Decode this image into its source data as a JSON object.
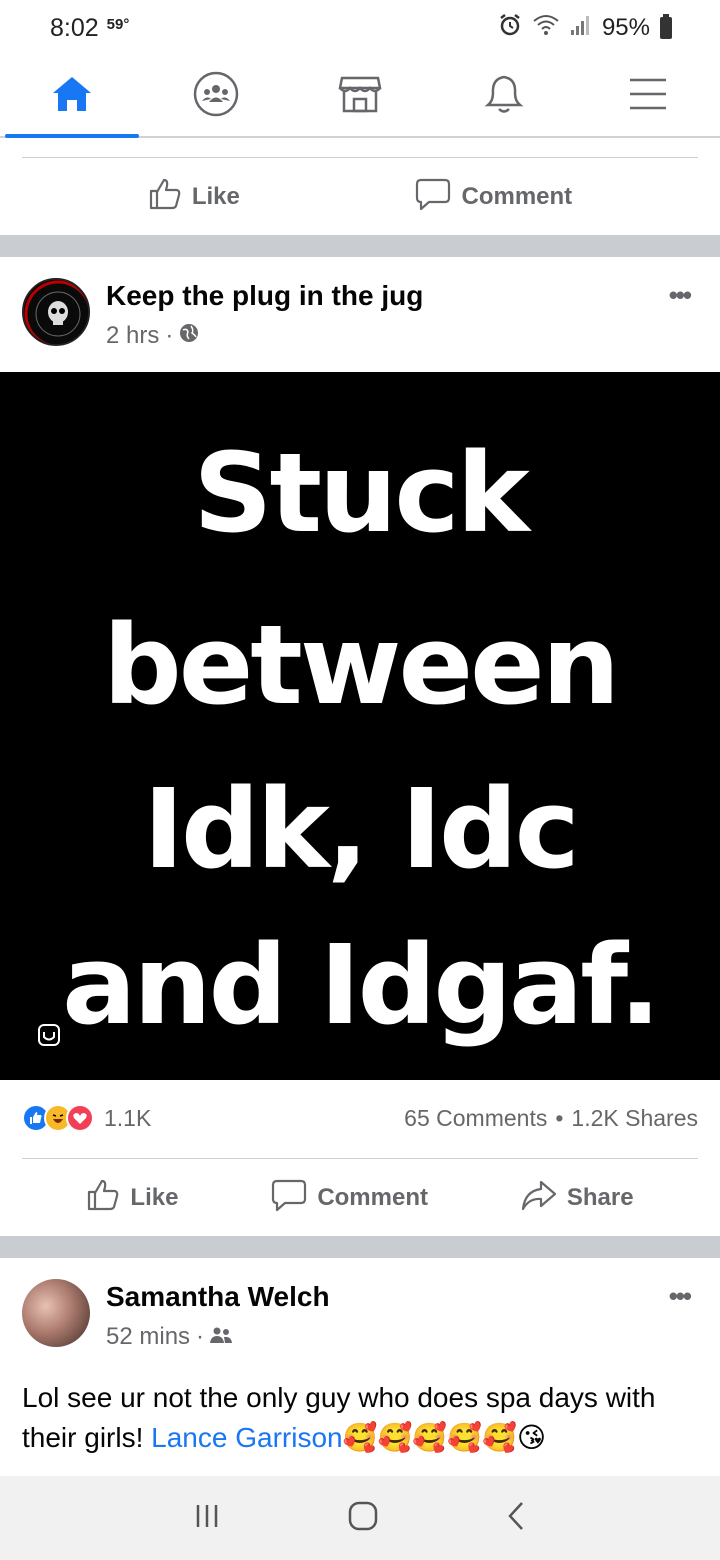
{
  "status_bar": {
    "time": "8:02",
    "temperature": "59°",
    "battery": "95%",
    "icons": [
      "alarm-icon",
      "wifi-icon",
      "signal-icon",
      "battery-icon"
    ]
  },
  "nav_tabs": [
    {
      "name": "home",
      "icon": "home-icon",
      "active": true
    },
    {
      "name": "groups",
      "icon": "groups-icon",
      "active": false
    },
    {
      "name": "marketplace",
      "icon": "marketplace-icon",
      "active": false
    },
    {
      "name": "notifications",
      "icon": "bell-icon",
      "active": false
    },
    {
      "name": "menu",
      "icon": "menu-icon",
      "active": false
    }
  ],
  "prev_post_actions": {
    "like": "Like",
    "comment": "Comment"
  },
  "post1": {
    "author": "Keep the plug in the jug",
    "time": "2 hrs",
    "privacy_icon": "globe-icon",
    "image_lines": [
      "Stuck",
      "between",
      "Idk, Idc",
      "and Idgaf."
    ],
    "reactions_count": "1.1K",
    "comments": "65 Comments",
    "shares": "1.2K Shares",
    "actions": {
      "like": "Like",
      "comment": "Comment",
      "share": "Share"
    }
  },
  "post2": {
    "author": "Samantha Welch",
    "time": "52 mins",
    "privacy_icon": "friends-icon",
    "text": "Lol see ur not the only guy who does spa days with their girls!",
    "mention": "Lance Garrison",
    "emojis": "🥰🥰🥰🥰🥰😘"
  },
  "colors": {
    "accent": "#1877f2",
    "secondary_text": "#65676b",
    "separator": "#c9ccd1"
  }
}
